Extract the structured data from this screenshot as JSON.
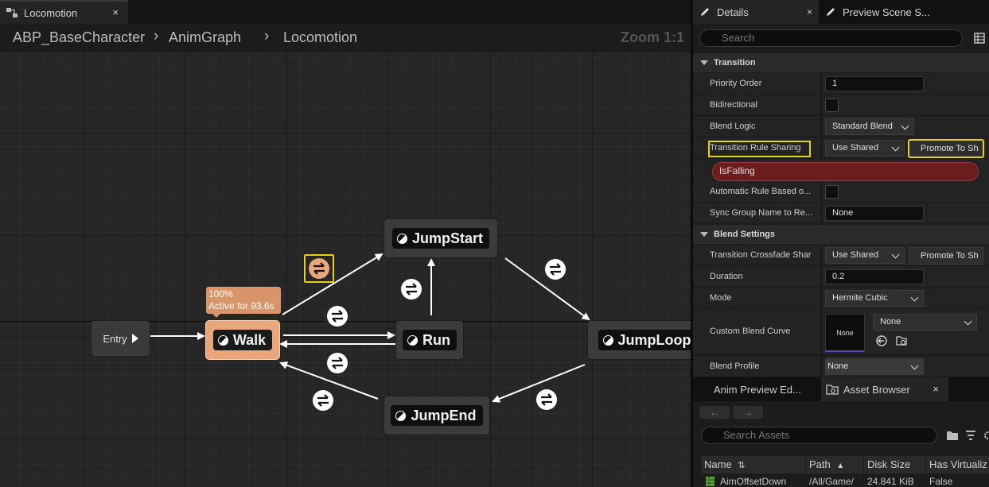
{
  "graph": {
    "tab_label": "Locomotion",
    "tab_close": "×",
    "breadcrumb": [
      "ABP_BaseCharacter",
      "AnimGraph",
      "Locomotion"
    ],
    "breadcrumb_separator": "›",
    "zoom": "Zoom 1:1",
    "entry_label": "Entry",
    "states": {
      "walk": "Walk",
      "run": "Run",
      "jump_start": "JumpStart",
      "jump_loop": "JumpLoop",
      "jump_end": "JumpEnd"
    },
    "walk_tooltip": {
      "weight": "100%",
      "active": "Active for 93.6s"
    },
    "colors": {
      "active_state": "#e8a77c",
      "selection_highlight": "#e6d21e"
    }
  },
  "details": {
    "tabs": [
      "Details",
      "Preview Scene S..."
    ],
    "tab_icons": [
      "pencil-icon",
      "pencil-icon"
    ],
    "search_placeholder": "Search",
    "sections": {
      "transition": "Transition",
      "blend_settings": "Blend Settings"
    },
    "transition": {
      "priority_order_label": "Priority Order",
      "priority_order_value": "1",
      "bidirectional_label": "Bidirectional",
      "bidirectional_checked": false,
      "blend_logic_label": "Blend Logic",
      "blend_logic_value": "Standard Blend",
      "rule_sharing_label": "Transition Rule Sharing",
      "rule_sharing_value": "Use Shared",
      "promote_button": "Promote To Sh",
      "rule_name": "IsFalling",
      "auto_rule_label": "Automatic Rule Based o...",
      "auto_rule_checked": false,
      "sync_group_label": "Sync Group Name to Re...",
      "sync_group_value": "None"
    },
    "blend": {
      "crossfade_label": "Transition Crossfade Shar",
      "crossfade_value": "Use Shared",
      "promote_button": "Promote To Sh",
      "duration_label": "Duration",
      "duration_value": "0.2",
      "mode_label": "Mode",
      "mode_value": "Hermite Cubic",
      "curve_label": "Custom Blend Curve",
      "curve_thumb": "None",
      "curve_value": "None",
      "profile_label": "Blend Profile",
      "profile_value": "None"
    }
  },
  "assets": {
    "tabs": [
      "Anim Preview Ed...",
      "Asset Browser"
    ],
    "tab_close": "×",
    "back": "←",
    "forward": "→",
    "search_placeholder": "Search Assets",
    "columns": [
      "Name",
      "Path",
      "Disk Size",
      "Has Virtualiz"
    ],
    "sort_indicators": [
      "⇅",
      "▲"
    ],
    "rows": [
      {
        "name": "AimOffsetDown",
        "path": "/All/Game/",
        "size": "24.841 KiB",
        "virtualized": "False"
      }
    ]
  }
}
